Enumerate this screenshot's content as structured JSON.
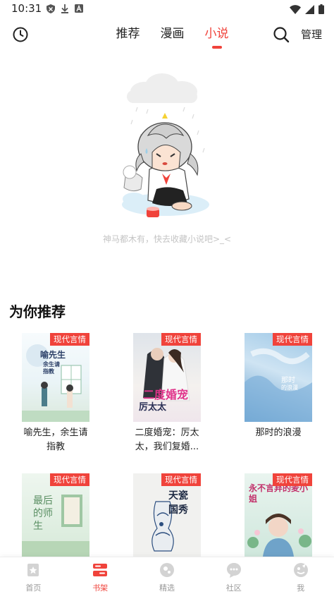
{
  "status_bar": {
    "time": "10:31"
  },
  "top_nav": {
    "tabs": [
      {
        "label": "推荐"
      },
      {
        "label": "漫画"
      },
      {
        "label": "小说"
      }
    ],
    "manage_label": "管理",
    "accent_color": "#f0433b"
  },
  "empty_state": {
    "message": "神马都木有，快去收藏小说吧>_<"
  },
  "recommend": {
    "title": "为你推荐",
    "books": [
      {
        "title_line1": "喻先生，余生请",
        "title_line2": "指教",
        "tag": "现代言情",
        "cover_text": "喻先生",
        "cover_sub": "余生请指教"
      },
      {
        "title_line1": "二度婚宠：厉太",
        "title_line2": "太，我们复婚...",
        "tag": "现代言情",
        "cover_text": "二度婚宠",
        "cover_sub": "厉太太"
      },
      {
        "title_line1": "那时的浪漫",
        "title_line2": "",
        "tag": "现代言情",
        "cover_text": "那时",
        "cover_sub": "的浪漫"
      },
      {
        "tag": "现代言情",
        "cover_text": "最后的师生"
      },
      {
        "tag": "现代言情",
        "cover_text": "天瓷国秀"
      },
      {
        "tag": "现代言情",
        "cover_text": "永不言弃的麦小姐"
      }
    ]
  },
  "bottom_nav": {
    "items": [
      {
        "label": "首页"
      },
      {
        "label": "书架"
      },
      {
        "label": "精选"
      },
      {
        "label": "社区"
      },
      {
        "label": "我"
      }
    ]
  }
}
